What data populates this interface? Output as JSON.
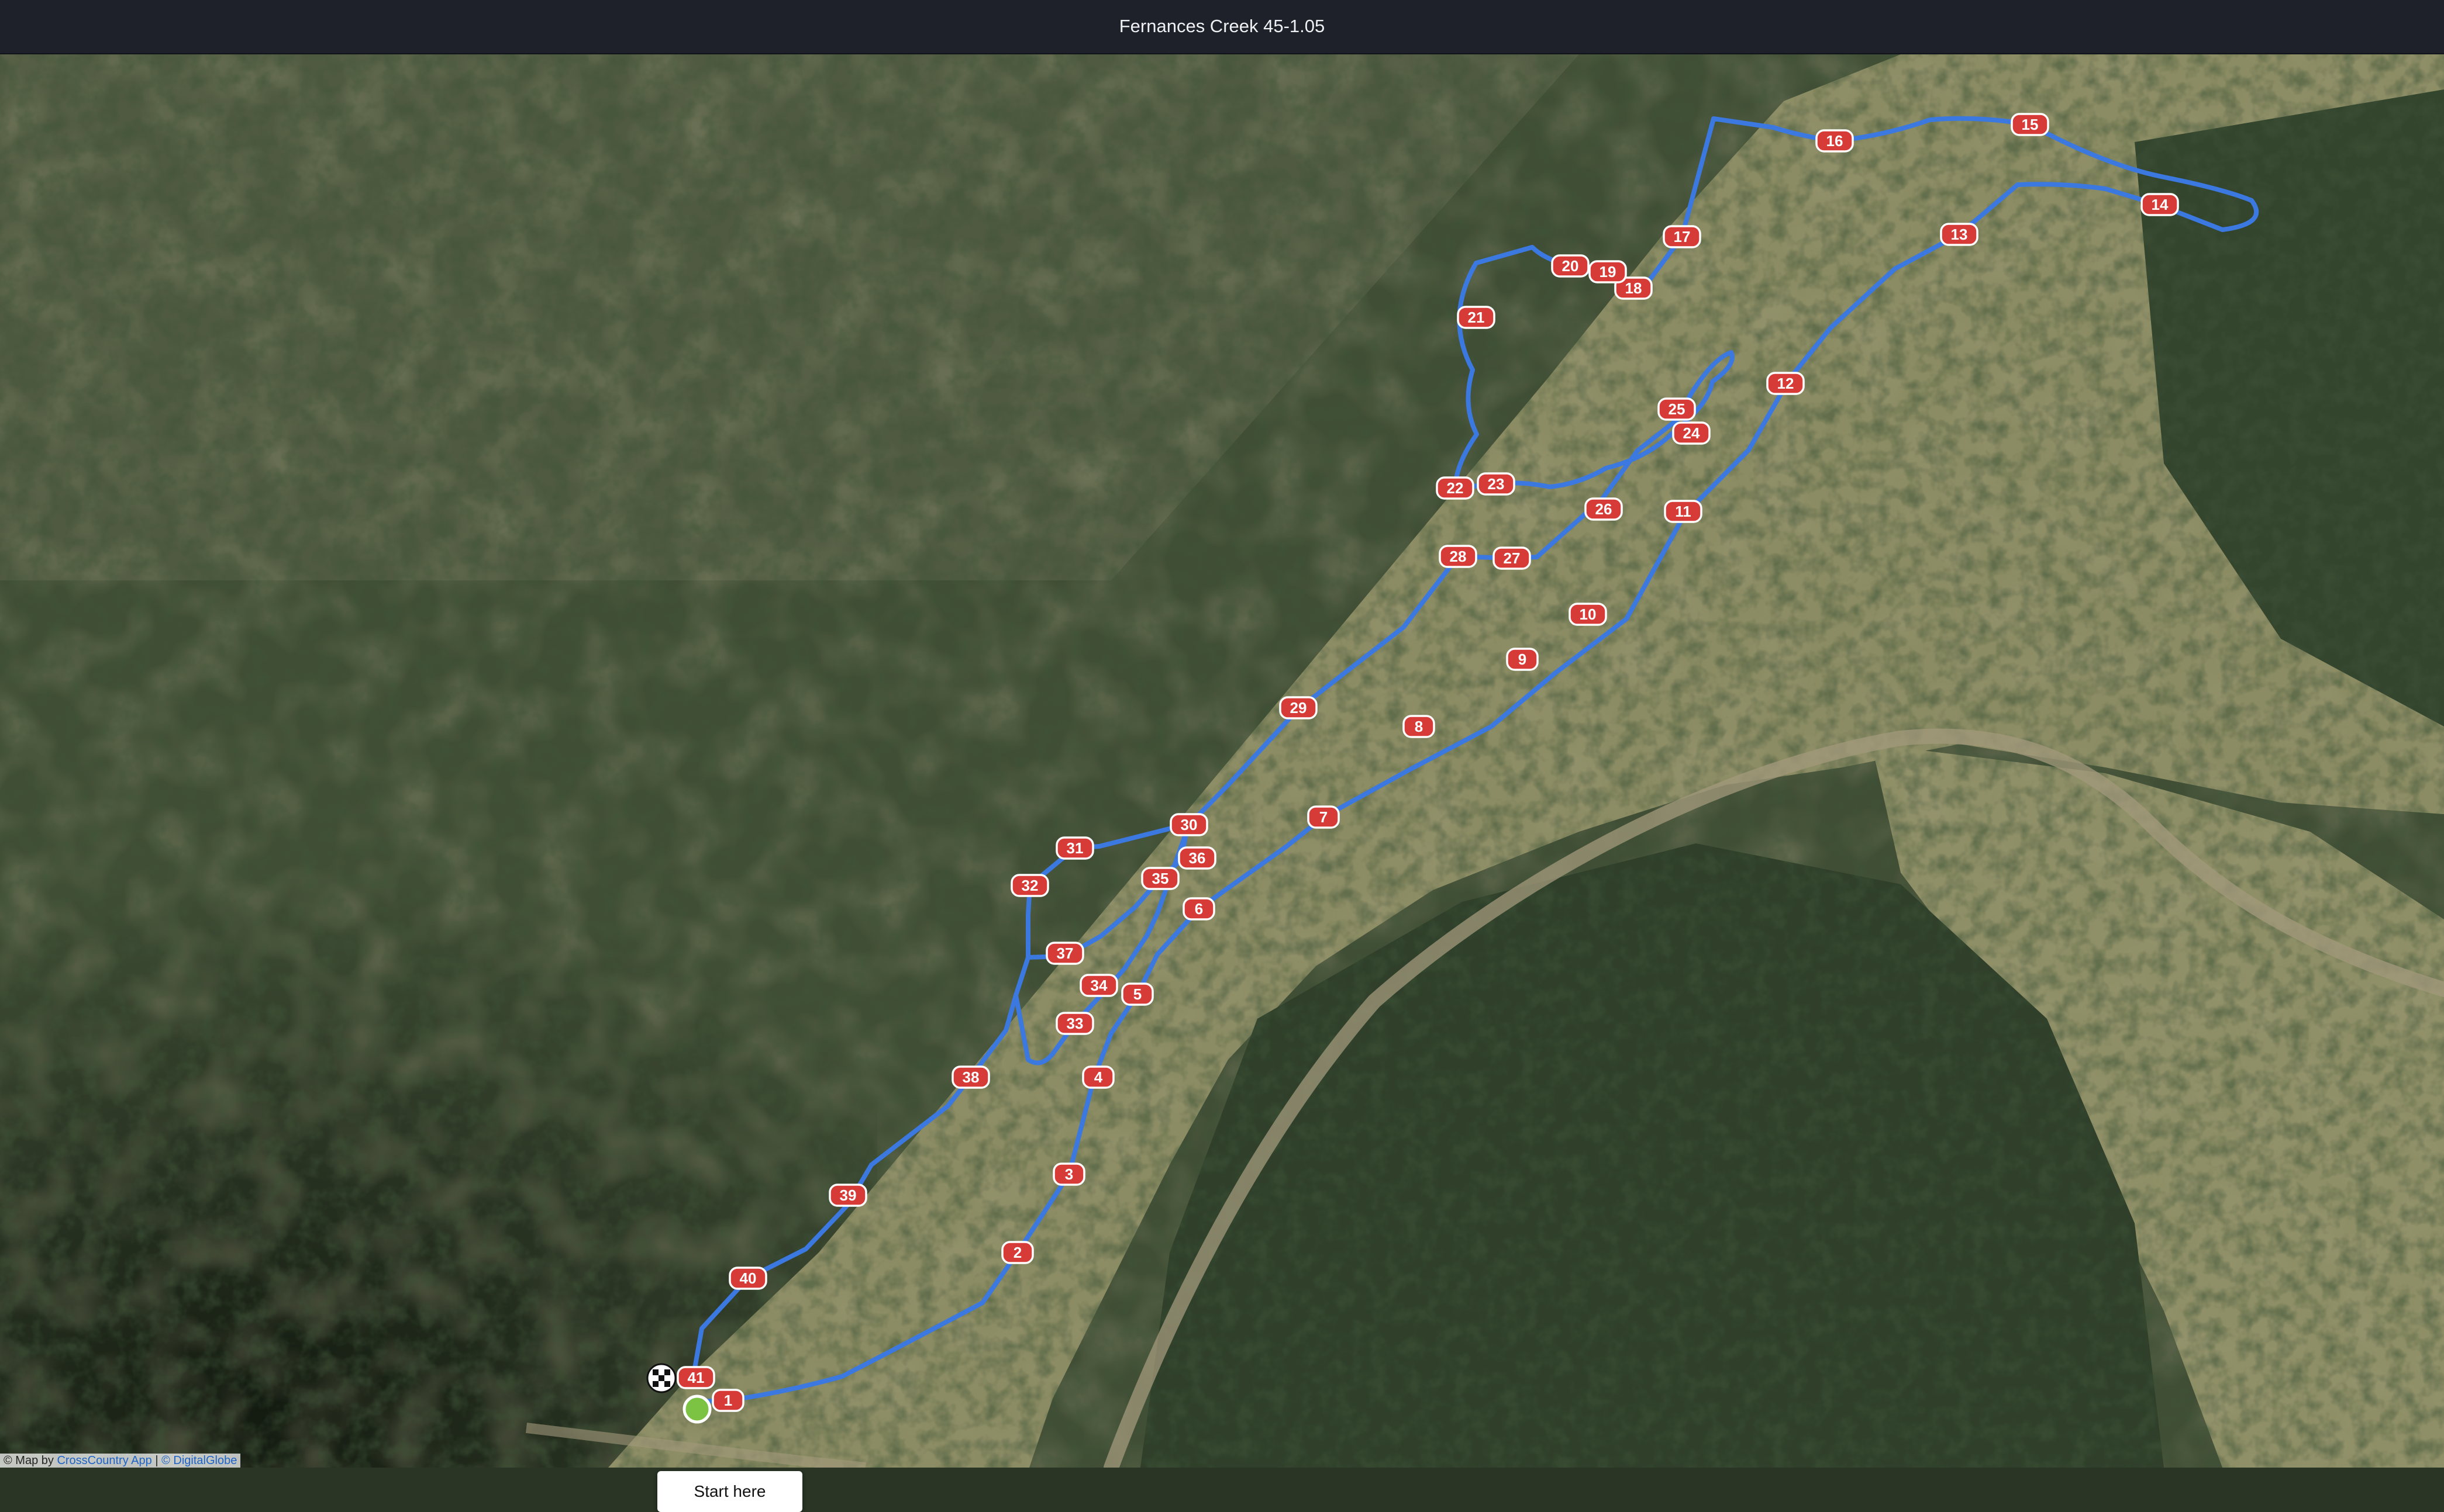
{
  "window": {
    "title": "Fernances Creek 45-1.05"
  },
  "map": {
    "type": "satellite",
    "course_color": "#3b78e0",
    "marker_color": "#d73b37",
    "start_marker_color": "#7cc243",
    "finish_marker_icon": "checkered-flag-icon",
    "start_button_label": "Start here",
    "markers": [
      "1",
      "2",
      "3",
      "4",
      "5",
      "6",
      "7",
      "8",
      "9",
      "10",
      "11",
      "12",
      "13",
      "14",
      "15",
      "16",
      "17",
      "18",
      "19",
      "20",
      "21",
      "22",
      "23",
      "24",
      "25",
      "26",
      "27",
      "28",
      "29",
      "30",
      "31",
      "32",
      "33",
      "34",
      "35",
      "36",
      "37",
      "38",
      "39",
      "40",
      "41"
    ]
  },
  "attribution": {
    "prefix": "© Map by",
    "app_link": "CrossCountry App",
    "separator": "|",
    "imagery_link": "© DigitalGlobe"
  }
}
